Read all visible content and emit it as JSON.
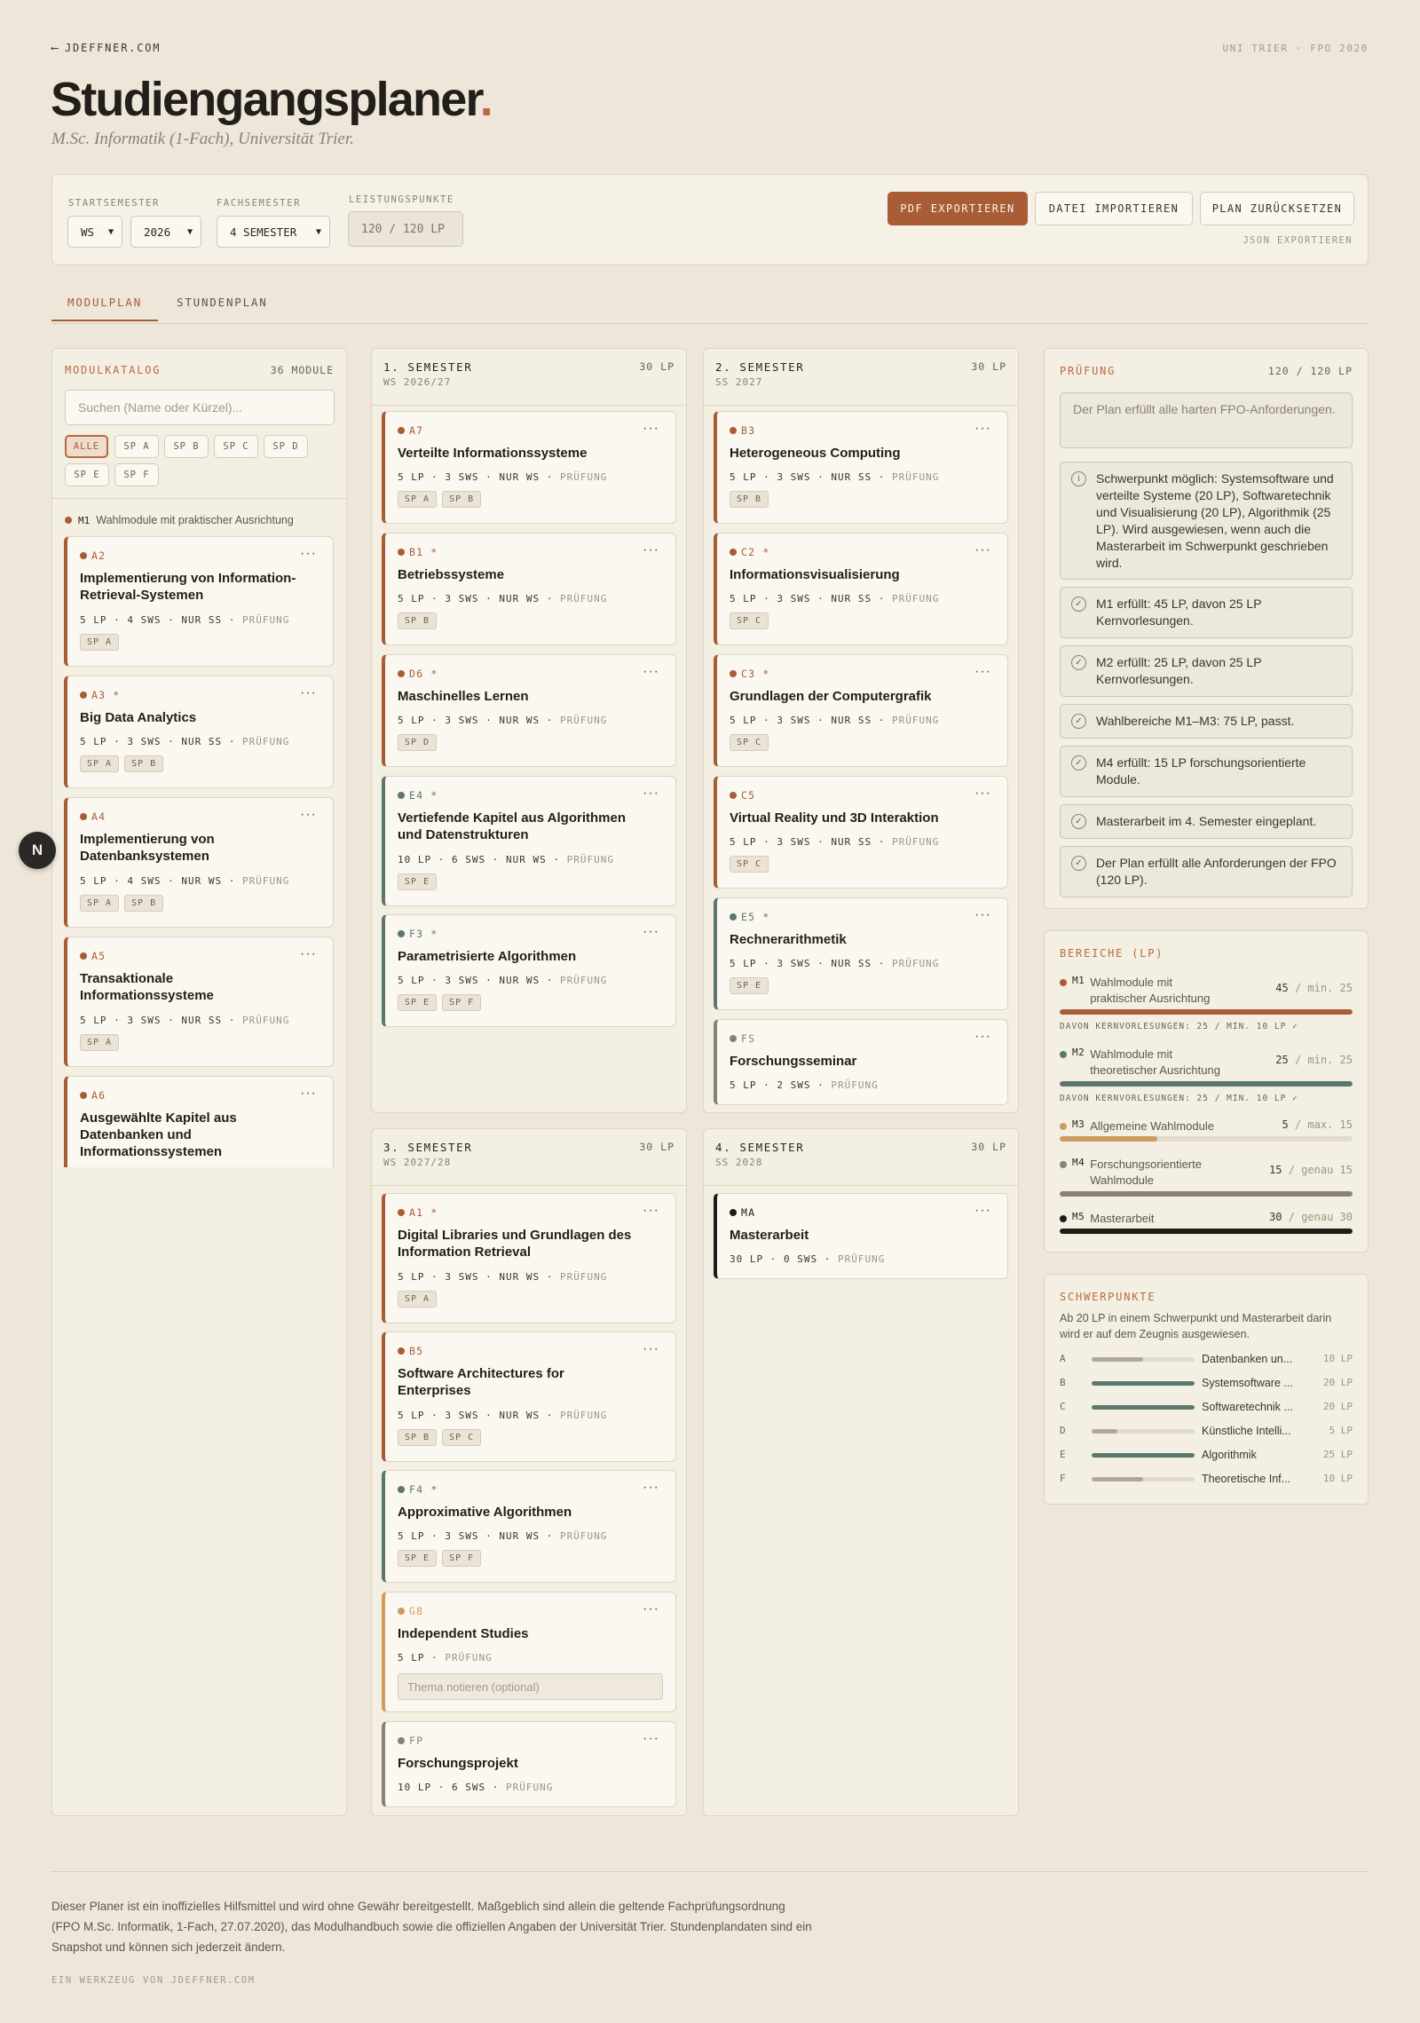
{
  "topbar": {
    "back_arrow": "⟵",
    "back_label": "JDEFFNER.COM",
    "context_label": "UNI TRIER · FPO 2020"
  },
  "header": {
    "title": "Studiengangsplaner",
    "title_dot": ".",
    "subtitle": "M.Sc. Informatik (1-Fach), Universität Trier."
  },
  "settings": {
    "start_label": "STARTSEMESTER",
    "start_term": "WS",
    "start_year": "2026",
    "fach_label": "FACHSEMESTER",
    "fach_value": "4 SEMESTER",
    "lp_label": "LEISTUNGSPUNKTE",
    "lp_value": "120 / 120 LP",
    "pdf_button": "PDF EXPORTIEREN",
    "import_button": "DATEI IMPORTIEREN",
    "reset_button": "PLAN ZURÜCKSETZEN",
    "json_link": "JSON EXPORTIEREN"
  },
  "tabs": {
    "modulplan": "MODULPLAN",
    "stundenplan": "STUNDENPLAN"
  },
  "colors": {
    "m1": "#a85d36",
    "m2": "#5c776d",
    "m3": "#d19a5e",
    "m4": "#8a8174",
    "m5": "#1f1c18",
    "accent": "#b86a3e"
  },
  "catalog": {
    "title": "MODULKATALOG",
    "count": "36 MODULE",
    "search_placeholder": "Suchen (Name oder Kürzel)...",
    "filters": [
      "ALLE",
      "SP A",
      "SP B",
      "SP C",
      "SP D",
      "SP E",
      "SP F"
    ],
    "group_code": "M1",
    "group_name": "Wahlmodule mit praktischer Ausrichtung",
    "cards": [
      {
        "code": "A2",
        "title": "Implementierung von Information-Retrieval-Systemen",
        "lp": "5 LP",
        "sws": "4 SWS",
        "term": "NUR SS",
        "exam": "PRÜFUNG",
        "tags": [
          "SP A"
        ]
      },
      {
        "code": "A3 *",
        "title": "Big Data Analytics",
        "lp": "5 LP",
        "sws": "3 SWS",
        "term": "NUR SS",
        "exam": "PRÜFUNG",
        "tags": [
          "SP A",
          "SP B"
        ]
      },
      {
        "code": "A4",
        "title": "Implementierung von Datenbanksystemen",
        "lp": "5 LP",
        "sws": "4 SWS",
        "term": "NUR WS",
        "exam": "PRÜFUNG",
        "tags": [
          "SP A",
          "SP B"
        ]
      },
      {
        "code": "A5",
        "title": "Transaktionale Informationssysteme",
        "lp": "5 LP",
        "sws": "3 SWS",
        "term": "NUR SS",
        "exam": "PRÜFUNG",
        "tags": [
          "SP A"
        ]
      },
      {
        "code": "A6",
        "title": "Ausgewählte Kapitel aus Datenbanken und Informationssystemen"
      }
    ]
  },
  "semesters": [
    {
      "name": "1. SEMESTER",
      "sub": "WS 2026/27",
      "lp": "30 LP",
      "cards": [
        {
          "code": "A7",
          "title": "Verteilte Informationssysteme",
          "lp": "5 LP",
          "sws": "3 SWS",
          "term": "NUR WS",
          "exam": "PRÜFUNG",
          "tags": [
            "SP A",
            "SP B"
          ]
        },
        {
          "code": "B1 *",
          "title": "Betriebssysteme",
          "lp": "5 LP",
          "sws": "3 SWS",
          "term": "NUR WS",
          "exam": "PRÜFUNG",
          "tags": [
            "SP B"
          ]
        },
        {
          "code": "D6 *",
          "title": "Maschinelles Lernen",
          "lp": "5 LP",
          "sws": "3 SWS",
          "term": "NUR WS",
          "exam": "PRÜFUNG",
          "tags": [
            "SP D"
          ]
        },
        {
          "code": "E4 *",
          "title": "Vertiefende Kapitel aus Algorithmen und Datenstrukturen",
          "lp": "10 LP",
          "sws": "6 SWS",
          "term": "NUR WS",
          "exam": "PRÜFUNG",
          "tags": [
            "SP E"
          ]
        },
        {
          "code": "F3 *",
          "title": "Parametrisierte Algorithmen",
          "lp": "5 LP",
          "sws": "3 SWS",
          "term": "NUR WS",
          "exam": "PRÜFUNG",
          "tags": [
            "SP E",
            "SP F"
          ]
        }
      ]
    },
    {
      "name": "2. SEMESTER",
      "sub": "SS 2027",
      "lp": "30 LP",
      "cards": [
        {
          "code": "B3",
          "title": "Heterogeneous Computing",
          "lp": "5 LP",
          "sws": "3 SWS",
          "term": "NUR SS",
          "exam": "PRÜFUNG",
          "tags": [
            "SP B"
          ]
        },
        {
          "code": "C2 *",
          "title": "Informationsvisualisierung",
          "lp": "5 LP",
          "sws": "3 SWS",
          "term": "NUR SS",
          "exam": "PRÜFUNG",
          "tags": [
            "SP C"
          ]
        },
        {
          "code": "C3 *",
          "title": "Grundlagen der Computergrafik",
          "lp": "5 LP",
          "sws": "3 SWS",
          "term": "NUR SS",
          "exam": "PRÜFUNG",
          "tags": [
            "SP C"
          ]
        },
        {
          "code": "C5",
          "title": "Virtual Reality und 3D Interaktion",
          "lp": "5 LP",
          "sws": "3 SWS",
          "term": "NUR SS",
          "exam": "PRÜFUNG",
          "tags": [
            "SP C"
          ]
        },
        {
          "code": "E5 *",
          "title": "Rechnerarithmetik",
          "lp": "5 LP",
          "sws": "3 SWS",
          "term": "NUR SS",
          "exam": "PRÜFUNG",
          "tags": [
            "SP E"
          ]
        },
        {
          "code": "FS",
          "title": "Forschungsseminar",
          "lp": "5 LP",
          "sws": "2 SWS",
          "exam": "PRÜFUNG"
        }
      ]
    },
    {
      "name": "3. SEMESTER",
      "sub": "WS 2027/28",
      "lp": "30 LP",
      "cards": [
        {
          "code": "A1 *",
          "title": "Digital Libraries und Grundlagen des Information Retrieval",
          "lp": "5 LP",
          "sws": "3 SWS",
          "term": "NUR WS",
          "exam": "PRÜFUNG",
          "tags": [
            "SP A"
          ]
        },
        {
          "code": "B5",
          "title": "Software Architectures for Enterprises",
          "lp": "5 LP",
          "sws": "3 SWS",
          "term": "NUR WS",
          "exam": "PRÜFUNG",
          "tags": [
            "SP B",
            "SP C"
          ]
        },
        {
          "code": "F4 *",
          "title": "Approximative Algorithmen",
          "lp": "5 LP",
          "sws": "3 SWS",
          "term": "NUR WS",
          "exam": "PRÜFUNG",
          "tags": [
            "SP E",
            "SP F"
          ]
        },
        {
          "code": "G8",
          "title": "Independent Studies",
          "lp": "5 LP",
          "exam": "PRÜFUNG",
          "note_placeholder": "Thema notieren (optional)"
        },
        {
          "code": "FP",
          "title": "Forschungsprojekt",
          "lp": "10 LP",
          "sws": "6 SWS",
          "exam": "PRÜFUNG"
        }
      ]
    },
    {
      "name": "4. SEMESTER",
      "sub": "SS 2028",
      "lp": "30 LP",
      "cards": [
        {
          "code": "MA",
          "title": "Masterarbeit",
          "lp": "30 LP",
          "sws": "0 SWS",
          "exam": "PRÜFUNG"
        }
      ]
    }
  ],
  "pruefung": {
    "title": "PRÜFUNG",
    "value": "120 / 120 LP",
    "summary": "Der Plan erfüllt alle harten FPO-Anforderungen.",
    "info_icon": "i",
    "check_icon": "✓",
    "info": "Schwerpunkt möglich: Systemsoftware und verteilte Systeme (20 LP), Softwaretechnik und Visualisierung (20 LP), Algorithmik (25 LP). Wird ausgewiesen, wenn auch die Masterarbeit im Schwerpunkt geschrieben wird.",
    "checks": [
      "M1 erfüllt: 45 LP, davon 25 LP Kernvorlesungen.",
      "M2 erfüllt: 25 LP, davon 25 LP Kernvorlesungen.",
      "Wahlbereiche M1–M3: 75 LP, passt.",
      "M4 erfüllt: 15 LP forschungsorientierte Module.",
      "Masterarbeit im 4. Semester eingeplant.",
      "Der Plan erfüllt alle Anforderungen der FPO (120 LP)."
    ]
  },
  "bereiche": {
    "title": "BEREICHE (LP)",
    "rows": [
      {
        "code": "M1",
        "name": "Wahlmodule mit praktischer Ausrichtung",
        "value": "45",
        "limit": "/ min. 25",
        "progress": 1.0,
        "kern": "DAVON KERNVORLESUNGEN: 25 / MIN. 10 LP ✓"
      },
      {
        "code": "M2",
        "name": "Wahlmodule mit theoretischer Ausrichtung",
        "value": "25",
        "limit": "/ min. 25",
        "progress": 1.0,
        "kern": "DAVON KERNVORLESUNGEN: 25 / MIN. 10 LP ✓"
      },
      {
        "code": "M3",
        "name": "Allgemeine Wahlmodule",
        "value": "5",
        "limit": "/ max. 15",
        "progress": 0.333
      },
      {
        "code": "M4",
        "name": "Forschungsorientierte Wahlmodule",
        "value": "15",
        "limit": "/ genau 15",
        "progress": 1.0
      },
      {
        "code": "M5",
        "name": "Masterarbeit",
        "value": "30",
        "limit": "/ genau 30",
        "progress": 1.0
      }
    ]
  },
  "schwerpunkte": {
    "title": "SCHWERPUNKTE",
    "desc": "Ab 20 LP in einem Schwerpunkt und Masterarbeit darin wird er auf dem Zeugnis ausgewiesen.",
    "rows": [
      {
        "letter": "A",
        "name": "Datenbanken un...",
        "value": "10 LP",
        "progress": 0.5,
        "reached": false
      },
      {
        "letter": "B",
        "name": "Systemsoftware ...",
        "value": "20 LP",
        "progress": 1.0,
        "reached": true
      },
      {
        "letter": "C",
        "name": "Softwaretechnik ...",
        "value": "20 LP",
        "progress": 1.0,
        "reached": true
      },
      {
        "letter": "D",
        "name": "Künstliche Intelli...",
        "value": "5 LP",
        "progress": 0.25,
        "reached": false
      },
      {
        "letter": "E",
        "name": "Algorithmik",
        "value": "25 LP",
        "progress": 1.0,
        "reached": true
      },
      {
        "letter": "F",
        "name": "Theoretische Inf...",
        "value": "10 LP",
        "progress": 0.5,
        "reached": false
      }
    ]
  },
  "footer": {
    "text": "Dieser Planer ist ein inoffizielles Hilfsmittel und wird ohne Gewähr bereitgestellt. Maßgeblich sind allein die geltende Fachprüfungsordnung (FPO M.Sc. Informatik, 1-Fach, 27.07.2020), das Modulhandbuch sowie die offiziellen Angaben der Universität Trier. Stundenplandaten sind ein Snapshot und können sich jederzeit ändern.",
    "signature": "EIN WERKZEUG VON JDEFFNER.COM"
  },
  "badge": {
    "letter": "N"
  }
}
